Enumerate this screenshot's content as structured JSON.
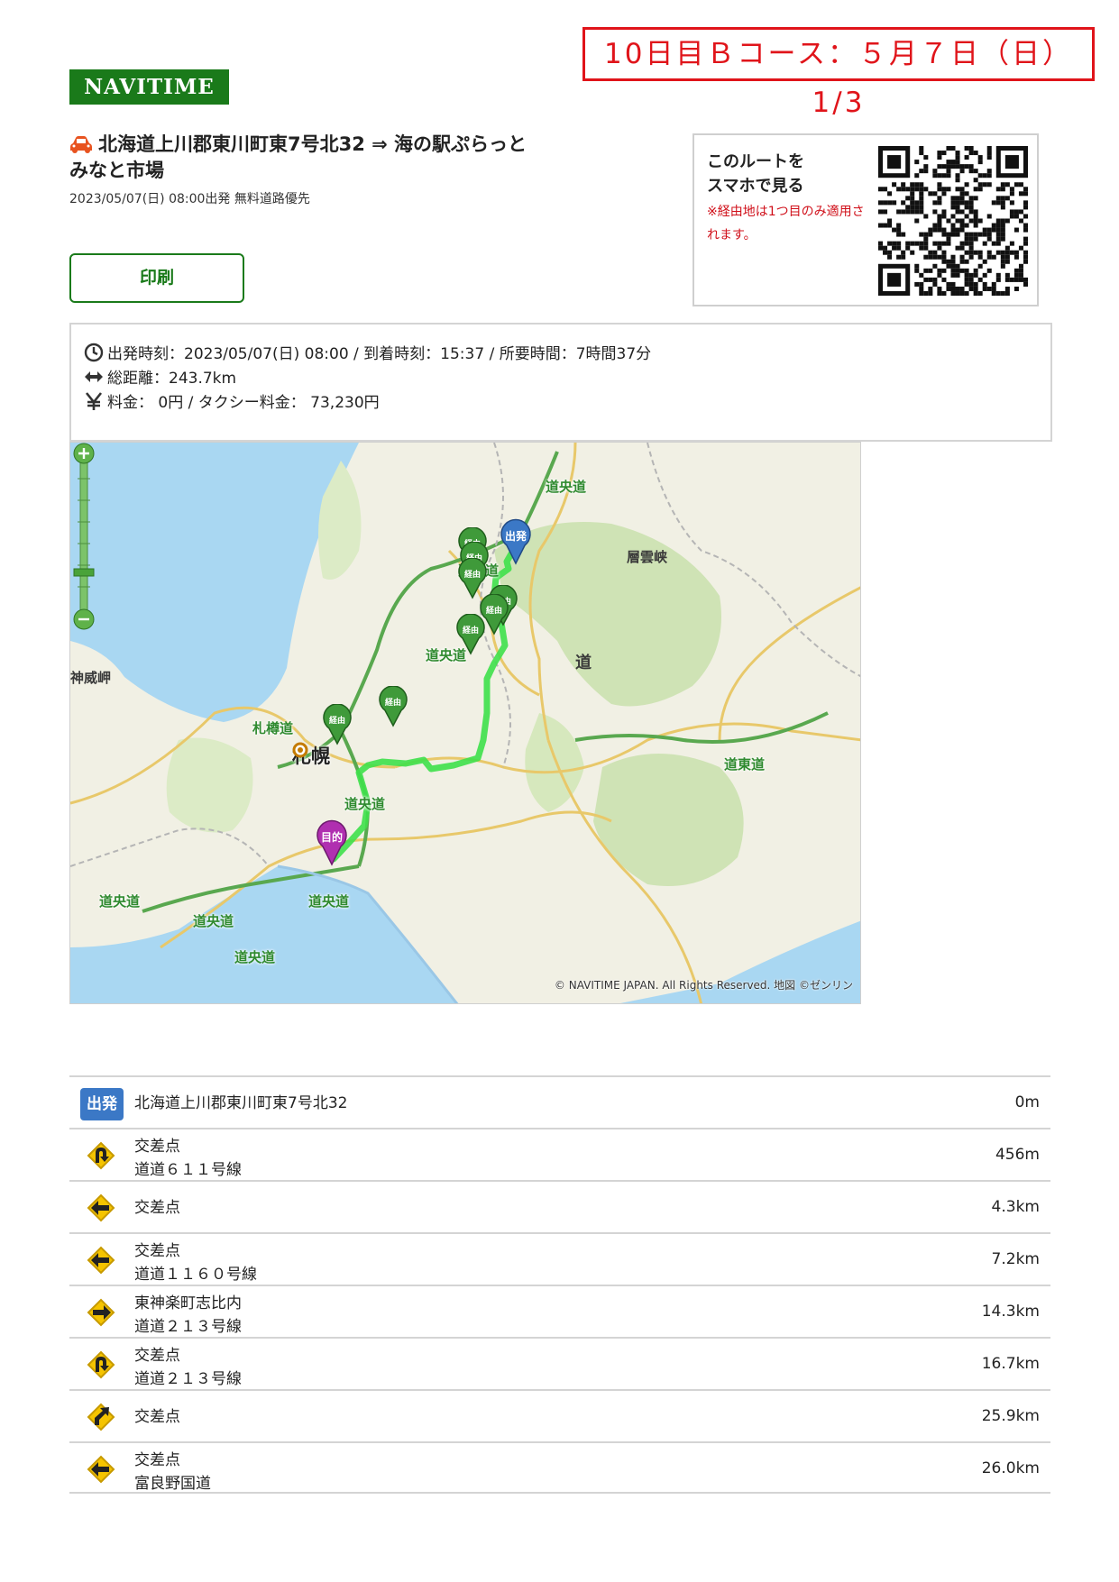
{
  "course_label": "10日目Ｂコース：５月７日（日）1/3",
  "logo": "NAVITIME",
  "route": {
    "title": "北海道上川郡東川町東7号北32 ⇒ 海の駅ぷらっとみなと市場",
    "subtitle": "2023/05/07(日) 08:00出発 無料道路優先"
  },
  "print_button": "印刷",
  "qr": {
    "title": "このルートを\nスマホで見る",
    "note": "※経由地は1つ目のみ適用されます。"
  },
  "summary": {
    "time": "出発時刻：2023/05/07(日) 08:00 / 到着時刻：15:37 / 所要時間：7時間37分",
    "distance": "総距離：243.7km",
    "fare": "料金： 0円 / タクシー料金： 73,230円"
  },
  "map": {
    "labels": {
      "douou1": "道央道",
      "sounkyo": "層雲峡",
      "douou2": "道央道",
      "douou3": "道央道",
      "kamui": "神威岬",
      "satsubetsu": "札樽道",
      "sapporo": "札幌",
      "douou4": "道央道",
      "doto": "道東道",
      "douou5": "道央道",
      "douou6": "道央道",
      "douou7": "道央道",
      "douou8": "道央道",
      "douou9": "道央道",
      "do_suffix": "道"
    },
    "markers": {
      "start": "出発",
      "goal": "目的",
      "via": "経由"
    },
    "copyright": "© NAVITIME JAPAN. All Rights Reserved. 地図 ©ゼンリン"
  },
  "steps": [
    {
      "badge": "出発",
      "line1": "北海道上川郡東川町東7号北32",
      "line2": "",
      "dist": "0m",
      "icon": "start-badge"
    },
    {
      "line1": "交差点",
      "line2": "道道６１１号線",
      "dist": "456m",
      "icon": "u-turn-icon"
    },
    {
      "line1": "交差点",
      "line2": "",
      "dist": "4.3km",
      "icon": "left-turn-icon"
    },
    {
      "line1": "交差点",
      "line2": "道道１１６０号線",
      "dist": "7.2km",
      "icon": "left-turn-icon"
    },
    {
      "line1": "東神楽町志比内",
      "line2": "道道２１３号線",
      "dist": "14.3km",
      "icon": "right-turn-icon"
    },
    {
      "line1": "交差点",
      "line2": "道道２１３号線",
      "dist": "16.7km",
      "icon": "u-turn-icon"
    },
    {
      "line1": "交差点",
      "line2": "",
      "dist": "25.9km",
      "icon": "slight-right-icon"
    },
    {
      "line1": "交差点",
      "line2": "富良野国道",
      "dist": "26.0km",
      "icon": "left-turn-icon"
    }
  ],
  "colors": {
    "brand_green": "#1a7a1a",
    "alert_red": "#e0141a",
    "route_green": "#3ee04a",
    "start_blue": "#3b78c6",
    "goal_purple": "#b02fb0",
    "sign_yellow": "#f5c400"
  }
}
